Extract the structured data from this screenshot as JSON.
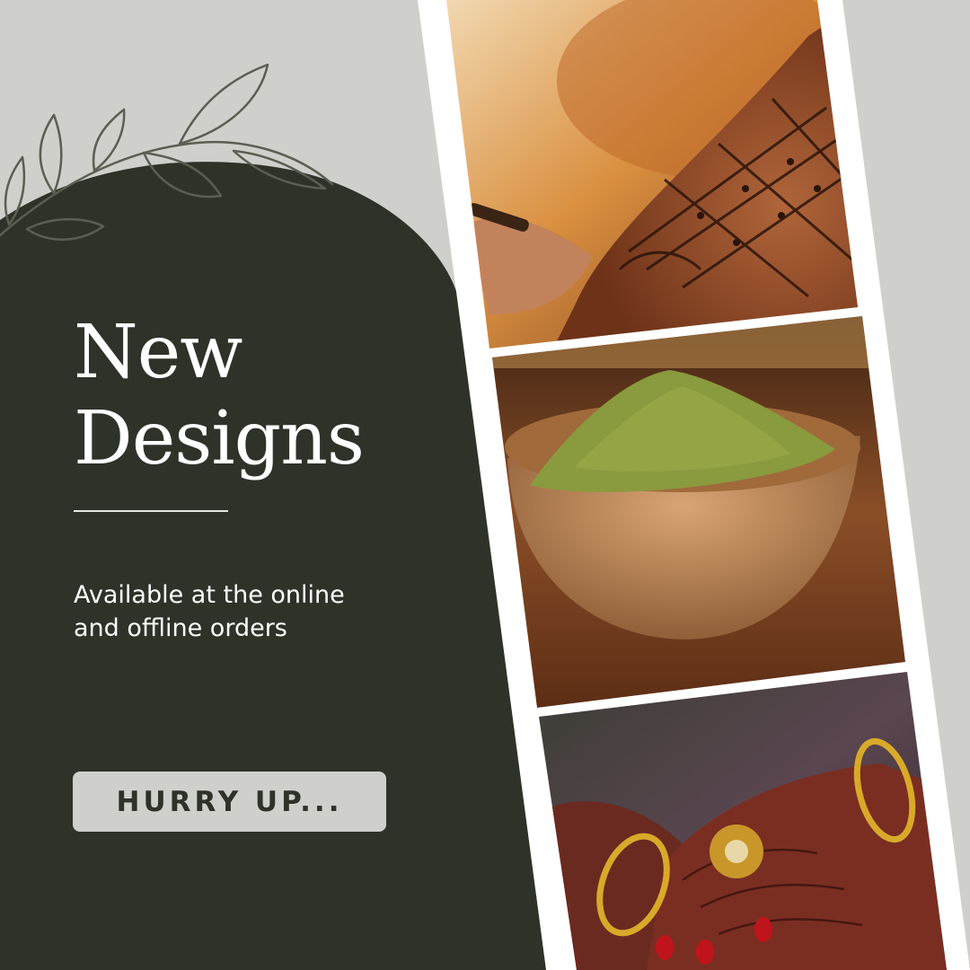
{
  "promo": {
    "title_line1": "New",
    "title_line2": "Designs",
    "subtitle_line1": "Available at the online",
    "subtitle_line2": "and offline orders",
    "cta_label": "HURRY UP..."
  },
  "icons": {
    "leaf_branch": "leaf-branch-outline"
  },
  "colors": {
    "background": "#cfd0cc",
    "panel": "#2f3229",
    "text": "#ffffff",
    "button": "#cfd0cc",
    "button_text": "#2f3229",
    "photo_frame": "#ffffff"
  }
}
